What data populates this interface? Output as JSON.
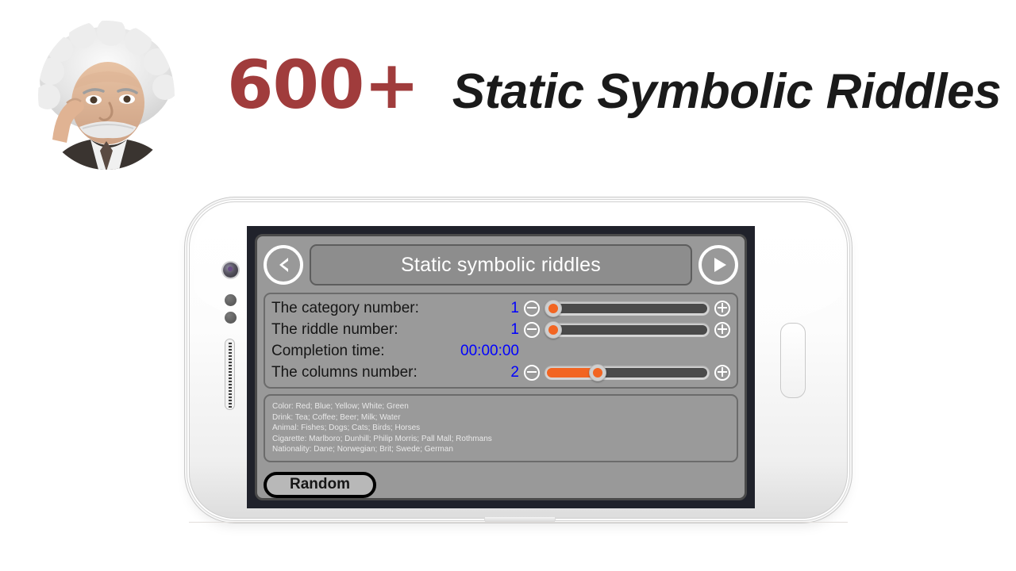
{
  "header": {
    "count": "600+",
    "title": "Static Symbolic Riddles",
    "count_color": "#a03c3c",
    "avatar_name": "einstein-avatar"
  },
  "app": {
    "screen_title": "Static symbolic riddles",
    "nav": {
      "back_icon": "chevron-left-icon",
      "forward_icon": "play-triangle-icon"
    },
    "params": [
      {
        "label": "The category number:",
        "value": "1",
        "has_slider": true,
        "fill_percent": 0,
        "knob_percent": 0,
        "minus_icon": "minus-circle-icon",
        "plus_icon": "plus-circle-icon"
      },
      {
        "label": "The riddle number:",
        "value": "1",
        "has_slider": true,
        "fill_percent": 0,
        "knob_percent": 0,
        "minus_icon": "minus-circle-icon",
        "plus_icon": "plus-circle-icon"
      },
      {
        "label": "Completion time:",
        "value": "00:00:00",
        "has_slider": false,
        "fill_percent": 0,
        "knob_percent": 0,
        "minus_icon": "",
        "plus_icon": ""
      },
      {
        "label": "The columns number:",
        "value": "2",
        "has_slider": true,
        "fill_percent": 29,
        "knob_percent": 29,
        "minus_icon": "minus-circle-icon",
        "plus_icon": "plus-circle-icon"
      }
    ],
    "categories": [
      "Color: Red; Blue; Yellow; White; Green",
      "Drink: Tea; Coffee; Beer; Milk; Water",
      "Animal: Fishes; Dogs; Cats; Birds; Horses",
      "Cigarette: Marlboro; Dunhill; Philip Morris; Pall Mall; Rothmans",
      "Nationality: Dane; Norwegian; Brit; Swede; German"
    ],
    "random_button": "Random",
    "colors": {
      "accent_orange": "#f26522",
      "value_blue": "#0000ff",
      "panel_gray": "#9a9a9a",
      "screen_bezel": "#20222b"
    }
  }
}
